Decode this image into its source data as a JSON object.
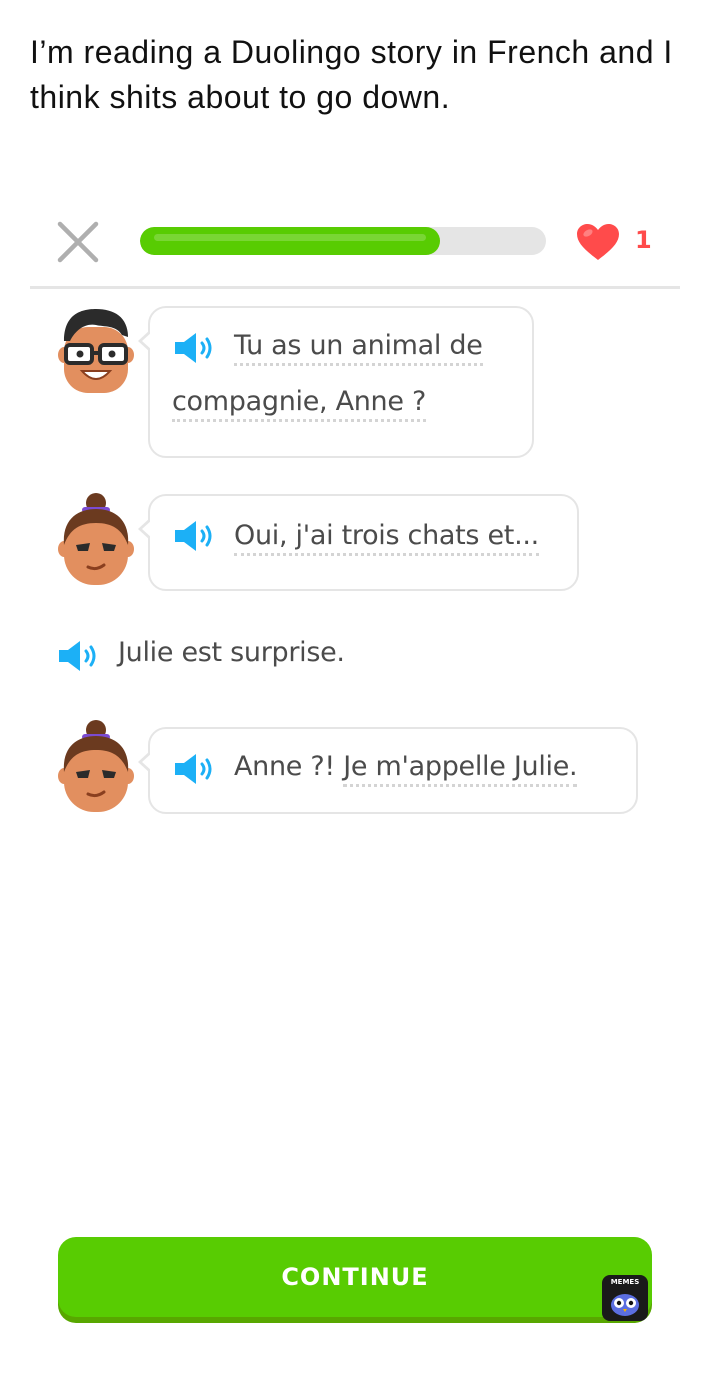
{
  "caption": "I’m reading a Duolingo story in French and I think shits about to go down.",
  "header": {
    "progress_fraction": 0.74,
    "hearts_count": "1",
    "colors": {
      "progress": "#58cc02",
      "heart": "#ff4b4b",
      "track": "#e5e5e5"
    }
  },
  "story": {
    "line1": {
      "part1": "Tu as un animal de",
      "part2": "compagnie, Anne ?"
    },
    "line2": {
      "text": "Oui, j'ai trois chats et..."
    },
    "narration": {
      "text": "Julie est surprise."
    },
    "line3": {
      "plain": "Anne ?! ",
      "dotted": "Je m'appelle Julie."
    }
  },
  "footer": {
    "continue_label": "CONTINUE",
    "watermark": "MEMES"
  },
  "icons": {
    "close": "close-icon",
    "heart": "heart-icon",
    "speaker": "speaker-icon",
    "avatar_man": "avatar-man-glasses",
    "avatar_woman": "avatar-woman-bun"
  }
}
